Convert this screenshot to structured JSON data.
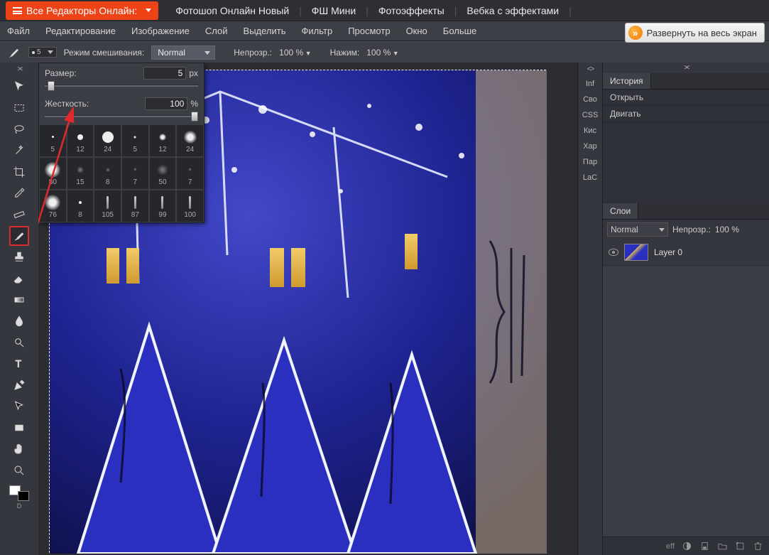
{
  "siteNav": {
    "dropdown": "Все Редакторы Онлайн:",
    "links": [
      "Фотошоп Онлайн Новый",
      "ФШ Мини",
      "Фотоэффекты",
      "Вебка с эффектами"
    ]
  },
  "appMenu": [
    "Файл",
    "Редактирование",
    "Изображение",
    "Слой",
    "Выделить",
    "Фильтр",
    "Просмотр",
    "Окно",
    "Больше"
  ],
  "expandLabel": "Развернуть на весь экран",
  "optBar": {
    "brushPresetSize": "5",
    "blendLabel": "Режим смешивания:",
    "blendMode": "Normal",
    "opacityLabel": "Непрозр.:",
    "opacityValue": "100 %",
    "flowLabel": "Нажим:",
    "flowValue": "100 %"
  },
  "brushPanel": {
    "sizeLabel": "Размер:",
    "sizeValue": "5",
    "sizeUnit": "px",
    "hardLabel": "Жесткость:",
    "hardValue": "100",
    "hardUnit": "%",
    "presets": [
      {
        "n": "5",
        "t": "dot",
        "s": 3
      },
      {
        "n": "12",
        "t": "dot",
        "s": 8
      },
      {
        "n": "24",
        "t": "dot",
        "s": 16
      },
      {
        "n": "5",
        "t": "soft",
        "s": 4
      },
      {
        "n": "12",
        "t": "soft",
        "s": 10
      },
      {
        "n": "24",
        "t": "soft",
        "s": 18
      },
      {
        "n": "80",
        "t": "soft",
        "s": 22
      },
      {
        "n": "15",
        "t": "tex",
        "s": 10
      },
      {
        "n": "8",
        "t": "tex",
        "s": 6
      },
      {
        "n": "7",
        "t": "tex",
        "s": 5
      },
      {
        "n": "50",
        "t": "tex",
        "s": 16
      },
      {
        "n": "7",
        "t": "tex",
        "s": 5
      },
      {
        "n": "76",
        "t": "soft",
        "s": 22
      },
      {
        "n": "8",
        "t": "dot",
        "s": 4
      },
      {
        "n": "105",
        "t": "line",
        "s": 18
      },
      {
        "n": "87",
        "t": "line",
        "s": 18
      },
      {
        "n": "99",
        "t": "line",
        "s": 18
      },
      {
        "n": "100",
        "t": "line",
        "s": 18
      }
    ]
  },
  "miniTabs": [
    "Inf",
    "Сво",
    "CSS",
    "Кис",
    "Хар",
    "Пар",
    "LaC"
  ],
  "historyTitle": "История",
  "historyItems": [
    "Открыть",
    "Двигать"
  ],
  "layersTitle": "Слои",
  "layersMode": "Normal",
  "layersOpacityLabel": "Непрозр.:",
  "layersOpacityValue": "100 %",
  "layerName": "Layer 0",
  "footerEff": "eff",
  "swatchD": "D"
}
